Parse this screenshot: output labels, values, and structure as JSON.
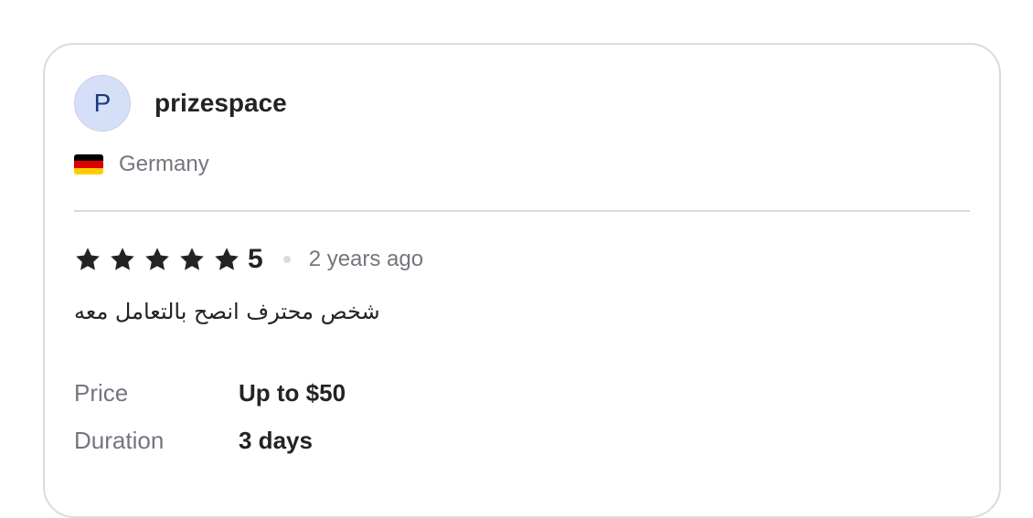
{
  "review": {
    "avatar_letter": "P",
    "username": "prizespace",
    "country": "Germany",
    "flag_colors": [
      "#000000",
      "#dd0000",
      "#ffce00"
    ],
    "rating": 5,
    "rating_label": "5",
    "time_ago": "2 years ago",
    "text": "شخص محترف انصح بالتعامل معه",
    "details": [
      {
        "label": "Price",
        "value": "Up to $50"
      },
      {
        "label": "Duration",
        "value": "3 days"
      }
    ]
  },
  "colors": {
    "star": "#222325",
    "muted": "#74767e",
    "avatar_bg": "#d5dff8"
  }
}
